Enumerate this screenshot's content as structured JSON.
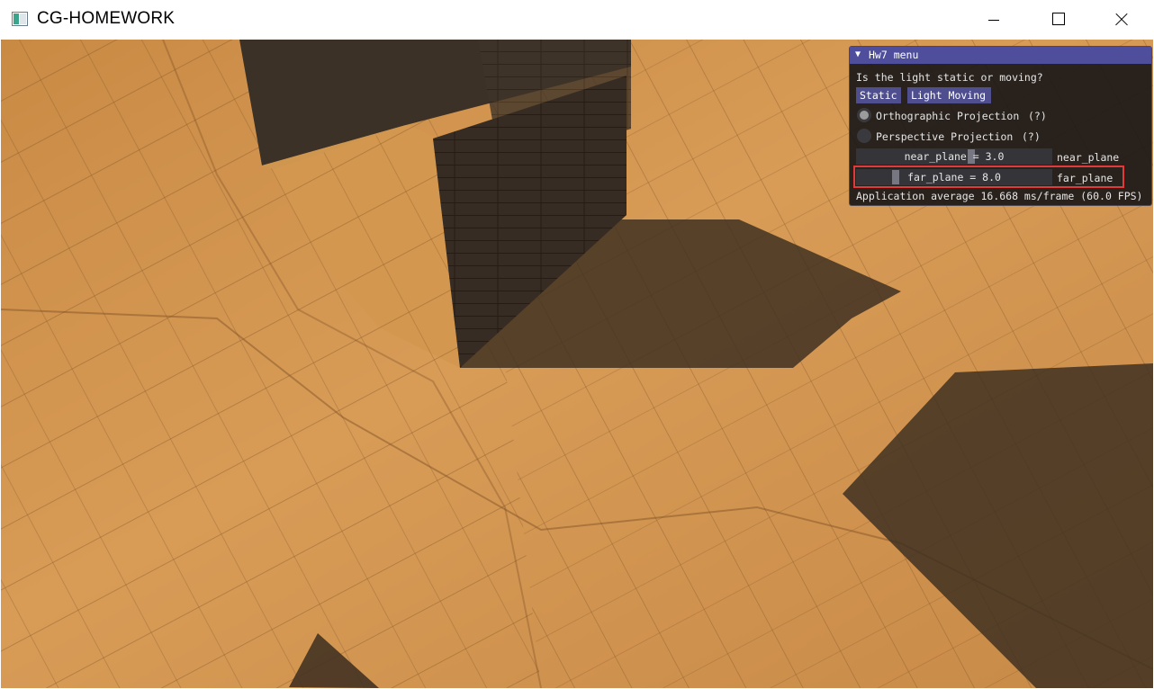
{
  "window": {
    "title": "CG-HOMEWORK"
  },
  "menu": {
    "title": "Hw7 menu",
    "question": "Is the light static or moving?",
    "buttons": {
      "static": "Static",
      "light_moving": "Light Moving"
    },
    "projections": [
      {
        "label": "Orthographic Projection",
        "help": "(?)",
        "selected": true
      },
      {
        "label": "Perspective Projection",
        "help": "(?)",
        "selected": false
      }
    ],
    "near_plane": {
      "display": "near_plane = 3.0",
      "label": "near_plane",
      "value": 3.0
    },
    "far_plane": {
      "display": "far_plane = 8.0",
      "label": "far_plane",
      "value": 8.0
    },
    "stats": "Application average 16.668 ms/frame (60.0 FPS)"
  },
  "colors": {
    "imgui_title_bg": "#4e4e9c",
    "imgui_button_bg": "#4f4f90",
    "highlight": "#e23a3a",
    "wood_light": "#d99a52",
    "wood_dark": "#3a2f24"
  }
}
